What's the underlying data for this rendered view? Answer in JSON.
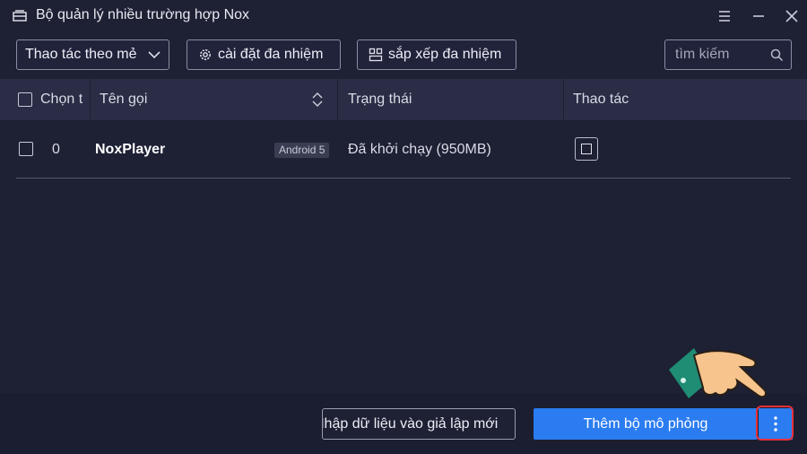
{
  "window": {
    "title": "Bộ quản lý nhiều trường hợp Nox",
    "icons": [
      "app-icon",
      "menu-icon",
      "minimize-icon",
      "close-icon"
    ]
  },
  "toolbar": {
    "bulk_action_label": "Thao tác theo mẻ",
    "multi_settings_label": "cài đặt đa nhiệm",
    "arrange_label": "sắp xếp đa nhiệm",
    "search_placeholder": "tìm kiếm"
  },
  "table": {
    "headers": {
      "select": "Chọn t",
      "name": "Tên gọi",
      "status": "Trạng thái",
      "action": "Thao tác"
    },
    "rows": [
      {
        "index": "0",
        "name": "NoxPlayer",
        "badge": "Android 5",
        "status": "Đã khởi chạy (950MB)"
      }
    ]
  },
  "footer": {
    "import_label": "Nhập dữ liệu vào giả lập mới",
    "add_label": "Thêm bộ mô phỏng"
  },
  "colors": {
    "background": "#1e2034",
    "header": "#2a2d45",
    "accent": "#2b7cf0",
    "highlight": "#e8303c"
  }
}
